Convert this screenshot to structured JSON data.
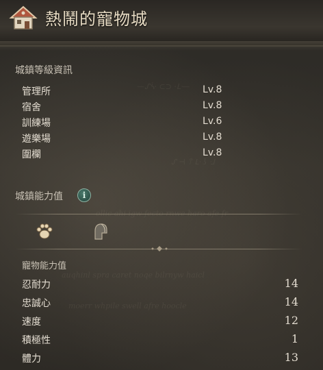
{
  "header": {
    "title": "熱鬧的寵物城",
    "icon": "house-icon"
  },
  "town_levels": {
    "title": "城鎮等級資訊",
    "rows": [
      {
        "label": "管理所",
        "value": "Lv.8"
      },
      {
        "label": "宿舍",
        "value": "Lv.8"
      },
      {
        "label": "訓練場",
        "value": "Lv.6"
      },
      {
        "label": "遊樂場",
        "value": "Lv.8"
      },
      {
        "label": "圍欄",
        "value": "Lv.8"
      }
    ]
  },
  "town_abilities": {
    "title": "城鎮能力值",
    "info_icon": "i",
    "tabs": [
      {
        "name": "paw-icon",
        "selected": true
      },
      {
        "name": "helmet-icon",
        "selected": false
      }
    ]
  },
  "pet_stats": {
    "title": "寵物能力值",
    "rows": [
      {
        "label": "忍耐力",
        "value": "14"
      },
      {
        "label": "忠誠心",
        "value": "14"
      },
      {
        "label": "速度",
        "value": "12"
      },
      {
        "label": "積極性",
        "value": "1"
      },
      {
        "label": "體力",
        "value": "13"
      }
    ]
  },
  "colors": {
    "text": "#e4ddd1",
    "title": "#e8dcc4",
    "info": "#4a7a6c"
  }
}
